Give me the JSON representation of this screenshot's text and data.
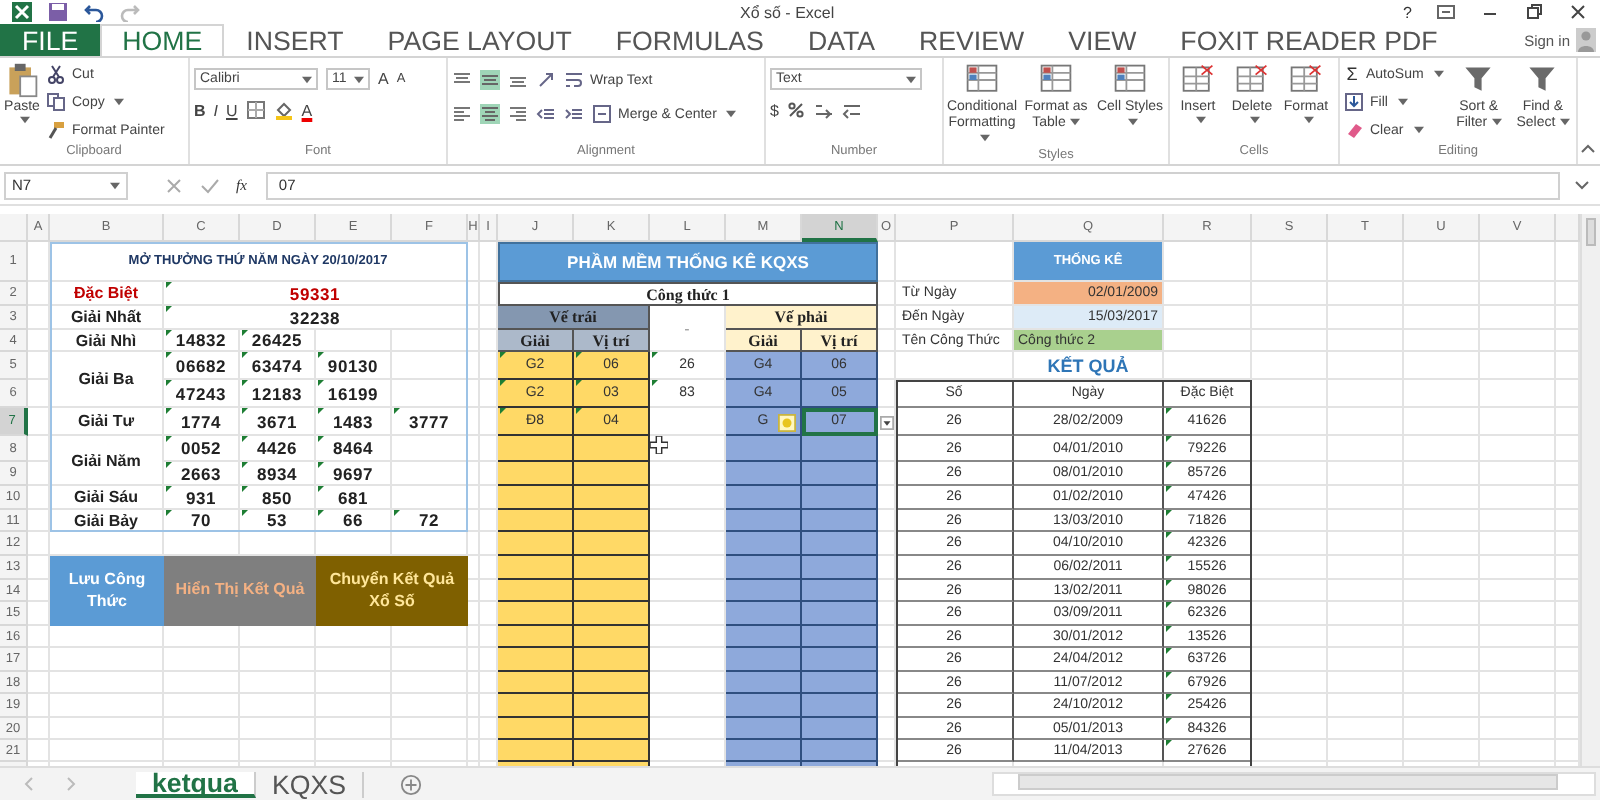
{
  "window": {
    "title": "Xổ số - Excel",
    "help": "?"
  },
  "ribbon": {
    "tabs": [
      {
        "label": "FILE",
        "kind": "file",
        "selected": false
      },
      {
        "label": "HOME",
        "kind": "tab",
        "selected": true
      },
      {
        "label": "INSERT",
        "kind": "tab",
        "selected": false
      },
      {
        "label": "PAGE LAYOUT",
        "kind": "tab",
        "selected": false
      },
      {
        "label": "FORMULAS",
        "kind": "tab",
        "selected": false
      },
      {
        "label": "DATA",
        "kind": "tab",
        "selected": false
      },
      {
        "label": "REVIEW",
        "kind": "tab",
        "selected": false
      },
      {
        "label": "VIEW",
        "kind": "tab",
        "selected": false
      },
      {
        "label": "FOXIT READER PDF",
        "kind": "tab",
        "selected": false
      }
    ],
    "sign_in": "Sign in",
    "clipboard": {
      "label": "Clipboard",
      "paste": "Paste",
      "cut": "Cut",
      "copy": "Copy",
      "format_painter": "Format Painter"
    },
    "font": {
      "label": "Font",
      "family": "Calibri",
      "size": "11",
      "grow": "A",
      "shrink": "A",
      "bold": "B",
      "italic": "I",
      "underline": "U",
      "font_color": "A"
    },
    "alignment": {
      "label": "Alignment",
      "wrap_text": "Wrap Text",
      "merge": "Merge & Center"
    },
    "number": {
      "label": "Number",
      "format": "Text",
      "currency": "$"
    },
    "styles": {
      "label": "Styles",
      "buttons": [
        "Conditional Formatting",
        "Format as Table",
        "Cell Styles"
      ]
    },
    "cells": {
      "label": "Cells",
      "buttons": [
        "Insert",
        "Delete",
        "Format"
      ]
    },
    "editing": {
      "label": "Editing",
      "autosum_icon": "Σ",
      "autosum": "AutoSum",
      "fill": "Fill",
      "clear": "Clear",
      "buttons": [
        "Sort & Filter",
        "Find & Select"
      ]
    }
  },
  "formula_bar": {
    "name_box": "N7",
    "fx": "fx",
    "value": "07"
  },
  "columns": [
    {
      "label": "A",
      "selected": false
    },
    {
      "label": "B",
      "selected": false
    },
    {
      "label": "C",
      "selected": false
    },
    {
      "label": "D",
      "selected": false
    },
    {
      "label": "E",
      "selected": false
    },
    {
      "label": "F",
      "selected": false
    },
    {
      "label": "H",
      "selected": false
    },
    {
      "label": "I",
      "selected": false
    },
    {
      "label": "J",
      "selected": false
    },
    {
      "label": "K",
      "selected": false
    },
    {
      "label": "L",
      "selected": false
    },
    {
      "label": "M",
      "selected": false
    },
    {
      "label": "N",
      "selected": true
    },
    {
      "label": "O",
      "selected": false
    },
    {
      "label": "P",
      "selected": false
    },
    {
      "label": "Q",
      "selected": false
    },
    {
      "label": "R",
      "selected": false
    },
    {
      "label": "S",
      "selected": false
    },
    {
      "label": "T",
      "selected": false
    },
    {
      "label": "U",
      "selected": false
    },
    {
      "label": "V",
      "selected": false
    }
  ],
  "rows": [
    {
      "label": "1",
      "selected": false
    },
    {
      "label": "2",
      "selected": false
    },
    {
      "label": "3",
      "selected": false
    },
    {
      "label": "4",
      "selected": false
    },
    {
      "label": "5",
      "selected": false
    },
    {
      "label": "6",
      "selected": false
    },
    {
      "label": "7",
      "selected": true
    },
    {
      "label": "8",
      "selected": false
    },
    {
      "label": "9",
      "selected": false
    },
    {
      "label": "10",
      "selected": false
    },
    {
      "label": "11",
      "selected": false
    },
    {
      "label": "12",
      "selected": false
    },
    {
      "label": "13",
      "selected": false
    },
    {
      "label": "14",
      "selected": false
    },
    {
      "label": "15",
      "selected": false
    },
    {
      "label": "16",
      "selected": false
    },
    {
      "label": "17",
      "selected": false
    },
    {
      "label": "18",
      "selected": false
    },
    {
      "label": "19",
      "selected": false
    },
    {
      "label": "20",
      "selected": false
    },
    {
      "label": "21",
      "selected": false
    }
  ],
  "lottery": {
    "title": "MỞ THƯỞNG THỨ NĂM NGÀY 20/10/2017",
    "prizes": [
      {
        "name": "Đặc Biệt",
        "kind": "special",
        "lines": [
          [
            "59331"
          ]
        ]
      },
      {
        "name": "Giải Nhất",
        "kind": "normal",
        "lines": [
          [
            "32238"
          ]
        ]
      },
      {
        "name": "Giải Nhì",
        "kind": "normal",
        "lines": [
          [
            "14832",
            "26425"
          ]
        ]
      },
      {
        "name": "Giải Ba",
        "kind": "normal",
        "lines": [
          [
            "06682",
            "63474",
            "90130"
          ],
          [
            "47243",
            "12183",
            "16199"
          ]
        ]
      },
      {
        "name": "Giải Tư",
        "kind": "normal",
        "lines": [
          [
            "1774",
            "3671",
            "1483",
            "3777"
          ]
        ]
      },
      {
        "name": "Giải Năm",
        "kind": "normal",
        "lines": [
          [
            "0052",
            "4426",
            "8464"
          ],
          [
            "2663",
            "8934",
            "9697"
          ]
        ]
      },
      {
        "name": "Giải Sáu",
        "kind": "normal",
        "lines": [
          [
            "931",
            "850",
            "681"
          ]
        ]
      },
      {
        "name": "Giải Bảy",
        "kind": "normal",
        "lines": [
          [
            "70",
            "53",
            "66",
            "72"
          ]
        ]
      }
    ]
  },
  "buttons": [
    {
      "label": "Lưu Công Thức",
      "color": "#5b9bd5"
    },
    {
      "label": "Hiển Thị Kết Quả",
      "color": "#7f7f7f"
    },
    {
      "label": "Chuyển Kết Quả Xổ Số",
      "color": "#7f6000"
    }
  ],
  "formula_panel": {
    "title": "PHẦM MỀM THỐNG KÊ KQXS",
    "formula": "Công thức 1",
    "separator": "-",
    "left": {
      "label": "Vế trái",
      "columns": [
        "Giải",
        "Vị trí"
      ],
      "rows": [
        [
          "G2",
          "06"
        ],
        [
          "G2",
          "03"
        ],
        [
          "Đ8",
          "04"
        ]
      ]
    },
    "middle_values": [
      "26",
      "83"
    ],
    "right": {
      "label": "Vế phải",
      "columns": [
        "Giải",
        "Vị trí"
      ],
      "rows": [
        [
          {
            "text": "G4",
            "selected": false
          },
          {
            "text": "06",
            "selected": false
          }
        ],
        [
          {
            "text": "G4",
            "selected": false
          },
          {
            "text": "05",
            "selected": false
          }
        ],
        [
          {
            "text": "G",
            "selected": false
          },
          {
            "text": "07",
            "selected": true
          }
        ]
      ]
    }
  },
  "statistics": {
    "title": "THỐNG KÊ",
    "filters": [
      {
        "label": "Từ Ngày",
        "value": "02/01/2009",
        "kind": "date",
        "color": "#f4b183"
      },
      {
        "label": "Đến Ngày",
        "value": "15/03/2017",
        "kind": "date",
        "color": "#ddebf7"
      },
      {
        "label": "Tên Công Thức",
        "value": "Công thức 2",
        "kind": "text",
        "color": "#a9d08e"
      }
    ],
    "results_title": "KẾT QUẢ",
    "columns": [
      "Số",
      "Ngày",
      "Đặc Biệt"
    ],
    "rows": [
      [
        "26",
        "28/02/2009",
        "41626"
      ],
      [
        "26",
        "04/01/2010",
        "79226"
      ],
      [
        "26",
        "08/01/2010",
        "85726"
      ],
      [
        "26",
        "01/02/2010",
        "47426"
      ],
      [
        "26",
        "13/03/2010",
        "71826"
      ],
      [
        "26",
        "04/10/2010",
        "42326"
      ],
      [
        "26",
        "06/02/2011",
        "15526"
      ],
      [
        "26",
        "13/02/2011",
        "98026"
      ],
      [
        "26",
        "03/09/2011",
        "62326"
      ],
      [
        "26",
        "30/01/2012",
        "13526"
      ],
      [
        "26",
        "24/04/2012",
        "63726"
      ],
      [
        "26",
        "11/07/2012",
        "67926"
      ],
      [
        "26",
        "24/10/2012",
        "25426"
      ],
      [
        "26",
        "05/01/2013",
        "84326"
      ],
      [
        "26",
        "11/04/2013",
        "27626"
      ]
    ]
  },
  "sheet_tabs": [
    {
      "label": "ketqua",
      "selected": true
    },
    {
      "label": "KQXS",
      "selected": false
    }
  ]
}
